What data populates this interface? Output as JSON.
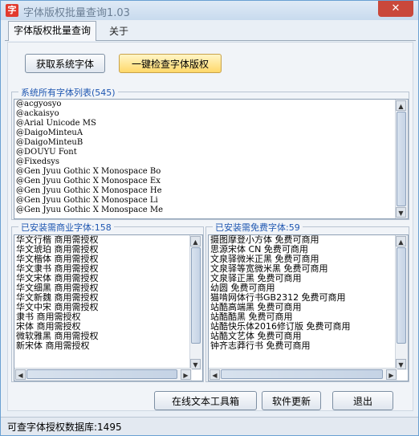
{
  "window": {
    "title": "字体版权批量查询1.03",
    "icon_text": "字",
    "close_label": "✕"
  },
  "tabs": [
    {
      "label": "字体版权批量查询"
    },
    {
      "label": "关于"
    }
  ],
  "toolbar": {
    "get_fonts_label": "获取系统字体",
    "check_copyright_label": "一键检查字体版权"
  },
  "all_fonts": {
    "title": "系统所有字体列表(545)",
    "items": [
      "@acgyosyo",
      "@ackaisyo",
      "@Arial Unicode MS",
      "@DaigoMinteuA",
      "@DaigoMinteuB",
      "@DOUYU Font",
      "@Fixedsys",
      "@Gen Jyuu Gothic X Monospace Bo",
      "@Gen Jyuu Gothic X Monospace Ex",
      "@Gen Jyuu Gothic X Monospace He",
      "@Gen Jyuu Gothic X Monospace Li",
      "@Gen Jyuu Gothic X Monospace Me"
    ]
  },
  "commercial_fonts": {
    "title": "已安装需商业字体:158",
    "items": [
      "华文行楷  商用需授权",
      "华文琥珀  商用需授权",
      "华文楷体  商用需授权",
      "华文隶书  商用需授权",
      "华文宋体  商用需授权",
      "华文细黑  商用需授权",
      "华文新魏  商用需授权",
      "华文中宋  商用需授权",
      "隶书  商用需授权",
      "宋体  商用需授权",
      "微软雅黑  商用需授权",
      "新宋体  商用需授权"
    ]
  },
  "free_fonts": {
    "title": "已安装需免费字体:59",
    "items": [
      "摄图摩登小方体  免费可商用",
      "思源宋体 CN  免费可商用",
      "文泉驿微米正黑  免费可商用",
      "文泉驿等宽微米黑  免费可商用",
      "文泉驿正黑  免费可商用",
      "幼圆  免费可商用",
      "猫啃网体行书GB2312  免费可商用",
      "站酷高端黑  免费可商用",
      "站酷酷黑  免费可商用",
      "站酷快乐体2016修订版  免费可商用",
      "站酷文艺体  免费可商用",
      "钟齐志莽行书  免费可商用"
    ]
  },
  "bottom_buttons": {
    "text_tools_label": "在线文本工具箱",
    "update_label": "软件更新",
    "exit_label": "退出"
  },
  "status": {
    "text": "可查字体授权数据库:1495"
  }
}
